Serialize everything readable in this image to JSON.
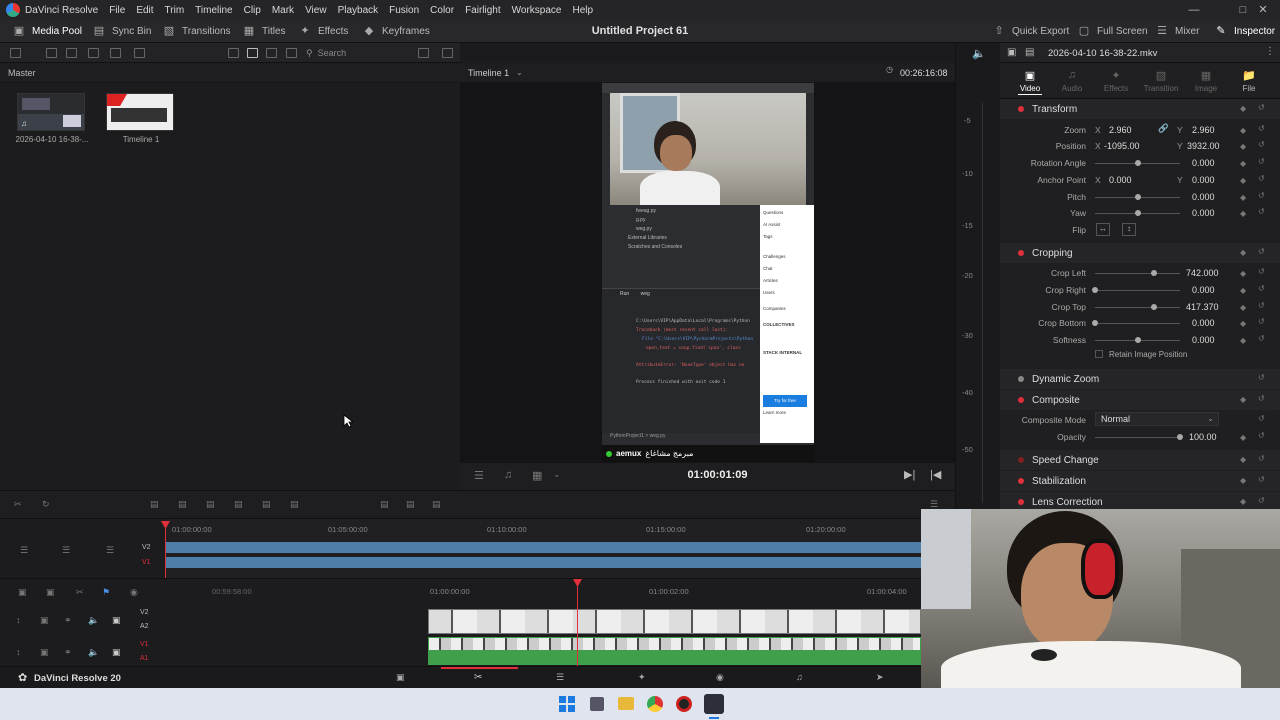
{
  "app": {
    "menus": [
      "DaVinci Resolve",
      "File",
      "Edit",
      "Trim",
      "Timeline",
      "Clip",
      "Mark",
      "View",
      "Playback",
      "Fusion",
      "Color",
      "Fairlight",
      "Workspace",
      "Help"
    ]
  },
  "toolbar": {
    "media_pool": "Media Pool",
    "sync_bin": "Sync Bin",
    "transitions": "Transitions",
    "titles": "Titles",
    "effects": "Effects",
    "keyframes": "Keyframes",
    "project_title": "Untitled Project 61",
    "quick_export": "Quick Export",
    "full_screen": "Full Screen",
    "mixer": "Mixer",
    "inspector": "Inspector"
  },
  "media_pool": {
    "search_placeholder": "Search",
    "bin": "Master",
    "clips": [
      {
        "label": "2026-04-10 16-38-..."
      },
      {
        "label": "Timeline 1"
      }
    ]
  },
  "viewer": {
    "timeline_name": "Timeline 1",
    "source_timecode": "00:26:16:08",
    "timecode": "01:00:01:09",
    "overlay": {
      "tree_items": [
        "fweag.py",
        "g.py",
        "weg.py",
        "External Libraries",
        "Scratches and Consoles"
      ],
      "run_tabs": [
        "Run",
        "weg"
      ],
      "console_lines": [
        "C:\\Users\\VIP\\AppData\\Local\\Programs\\Python",
        "Traceback (most recent call last):",
        "File \"C:\\Users\\VIP\\PycharmProjects\\Python",
        "open_text = soup.find('span', class",
        "AttributeError: 'NoneType' object has no",
        "Process finished with exit code 1"
      ],
      "breadcrumb": "PythonProject1 > weg.py",
      "so_items": [
        "Questions",
        "AI Assist",
        "Tags",
        "Challenges",
        "Chat",
        "Articles",
        "Users",
        "Companies",
        "COLLECTIVES",
        "STACK INTERNAL",
        "Try for free",
        "Learn more"
      ],
      "channel_badge": "aemux",
      "channel_arabic": "مبرمج مشاغاغ"
    }
  },
  "meters": {
    "scale": [
      "-5",
      "-10",
      "-15",
      "-20",
      "-30",
      "-40",
      "-50"
    ]
  },
  "inspector": {
    "clip_name": "2026-04-10 16-38-22.mkv",
    "tabs": [
      "Video",
      "Audio",
      "Effects",
      "Transition",
      "Image",
      "File"
    ],
    "transform": {
      "title": "Transform",
      "zoom": {
        "label": "Zoom",
        "x": "2.960",
        "y": "2.960"
      },
      "position": {
        "label": "Position",
        "x": "-1095.00",
        "y": "3932.00"
      },
      "rotation": {
        "label": "Rotation Angle",
        "value": "0.000"
      },
      "anchor": {
        "label": "Anchor Point",
        "x": "0.000",
        "y": "0.000"
      },
      "pitch": {
        "label": "Pitch",
        "value": "0.000"
      },
      "yaw": {
        "label": "Yaw",
        "value": "0.000"
      },
      "flip": {
        "label": "Flip"
      }
    },
    "cropping": {
      "title": "Cropping",
      "crop_left": {
        "label": "Crop Left",
        "value": "742.000"
      },
      "crop_right": {
        "label": "Crop Right",
        "value": "0.000"
      },
      "crop_top": {
        "label": "Crop Top",
        "value": "417.370"
      },
      "crop_bottom": {
        "label": "Crop Bottom",
        "value": "0.000"
      },
      "softness": {
        "label": "Softness",
        "value": "0.000"
      },
      "retain": "Retain Image Position"
    },
    "dynamic_zoom": "Dynamic Zoom",
    "composite": {
      "title": "Composite",
      "mode_label": "Composite Mode",
      "mode_value": "Normal",
      "opacity_label": "Opacity",
      "opacity_value": "100.00"
    },
    "speed_change": "Speed Change",
    "stabilization": "Stabilization",
    "lens_correction": "Lens Correction"
  },
  "timeline": {
    "upper_ruler": [
      "01:00:00:00",
      "01:05:00:00",
      "01:10:00:00",
      "01:15:00:00",
      "01:20:00:00"
    ],
    "lower_ruler": [
      "00:59:58:00",
      "01:00:00:00",
      "01:00:02:00",
      "01:00:04:00"
    ],
    "tracks_upper": [
      "V2",
      "V1"
    ],
    "tracks_lower": [
      "V2",
      "A2",
      "V1",
      "A1"
    ]
  },
  "footer": {
    "brand": "DaVinci Resolve 20"
  },
  "colors": {
    "accent_red": "#e0303a",
    "clip_blue": "#4d7fa8",
    "clip_green": "#3f9f4a",
    "inspector_active": "#ffffff"
  }
}
